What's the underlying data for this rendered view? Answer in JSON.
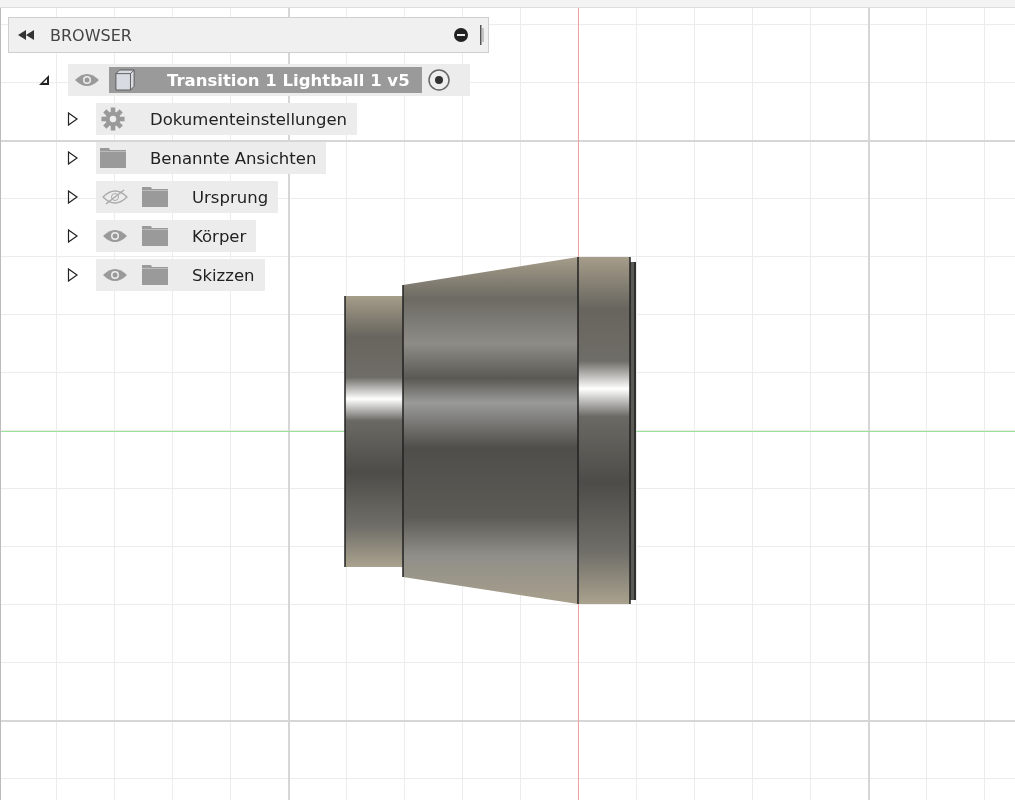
{
  "browser": {
    "title": "BROWSER",
    "root": {
      "label": "Transition 1 Lightball 1 v5",
      "expanded": true,
      "visible": true,
      "active": true,
      "children": [
        {
          "label": "Dokumenteinstellungen",
          "kind": "settings",
          "expanded": false
        },
        {
          "label": "Benannte Ansichten",
          "kind": "folder",
          "expanded": false
        },
        {
          "label": "Ursprung",
          "kind": "folder",
          "expanded": false,
          "visible": false
        },
        {
          "label": "Körper",
          "kind": "folder",
          "expanded": false,
          "visible": true
        },
        {
          "label": "Skizzen",
          "kind": "folder",
          "expanded": false,
          "visible": true
        }
      ]
    }
  }
}
